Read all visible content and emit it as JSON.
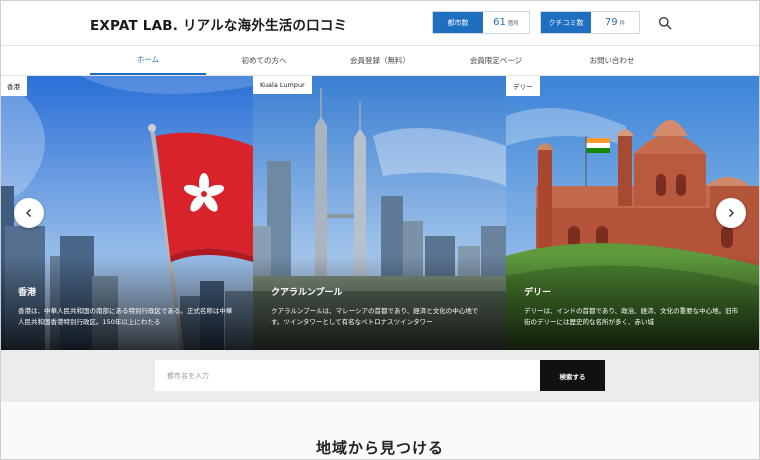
{
  "header": {
    "site_title": "EXPAT LAB. リアルな海外生活の口コミ",
    "stats": [
      {
        "label": "都市数",
        "value": "61",
        "unit": "箇所"
      },
      {
        "label": "クチコミ数",
        "value": "79",
        "unit": "件"
      }
    ],
    "search_icon": "search-icon"
  },
  "nav": {
    "items": [
      {
        "label": "ホーム",
        "active": true
      },
      {
        "label": "初めての方へ",
        "active": false
      },
      {
        "label": "会員登録（無料）",
        "active": false
      },
      {
        "label": "会員限定ページ",
        "active": false
      },
      {
        "label": "お問い合わせ",
        "active": false
      }
    ]
  },
  "slides": [
    {
      "tag": "香港",
      "name": "香港",
      "desc": "香港は、中華人民共和国の南部にある特別行政区である。正式名称は中華人民共和国香港特別行政区。150年以上にわたる"
    },
    {
      "tag": "Kuala Lumpur",
      "name": "クアラルンプール",
      "desc": "クアラルンプールは、マレーシアの首都であり、経済と文化の中心地です。ツインタワーとして有名なペトロナスツインタワー"
    },
    {
      "tag": "デリー",
      "name": "デリー",
      "desc": "デリーは、インドの首都であり、政治、経済、文化の重要な中心地。旧市街のデリーには歴史的な名所が多く、赤い城"
    }
  ],
  "search": {
    "placeholder": "都市名を入力",
    "button_label": "検索する"
  },
  "section": {
    "title": "地域から見つける"
  },
  "colors": {
    "accent": "#1f6fc0",
    "search_button": "#111111"
  }
}
